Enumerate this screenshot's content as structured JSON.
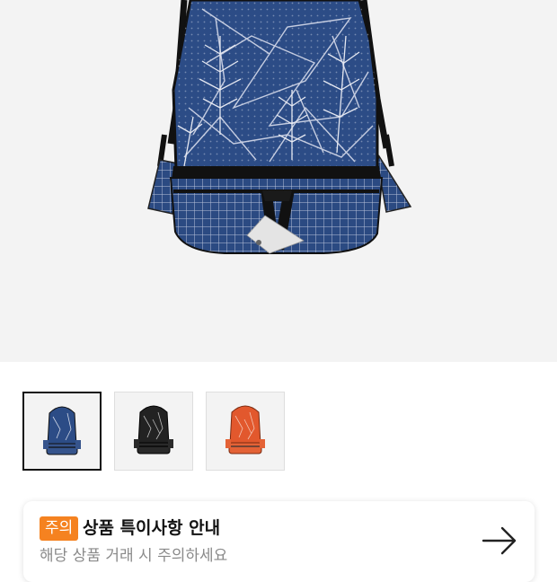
{
  "product": {
    "main_image_icon": "backpack-navy-icon",
    "colors": {
      "navy": "#2c4c86",
      "black": "#222222",
      "orange": "#e2582d"
    }
  },
  "thumbnails": [
    {
      "icon": "backpack-navy-icon",
      "selected": true
    },
    {
      "icon": "backpack-black-icon",
      "selected": false
    },
    {
      "icon": "backpack-orange-icon",
      "selected": false
    }
  ],
  "notice": {
    "badge": "주의",
    "title": "상품 특이사항 안내",
    "subtitle": "해당 상품 거래 시 주의하세요",
    "arrow_icon": "arrow-right-icon",
    "badge_color": "#f58220"
  }
}
